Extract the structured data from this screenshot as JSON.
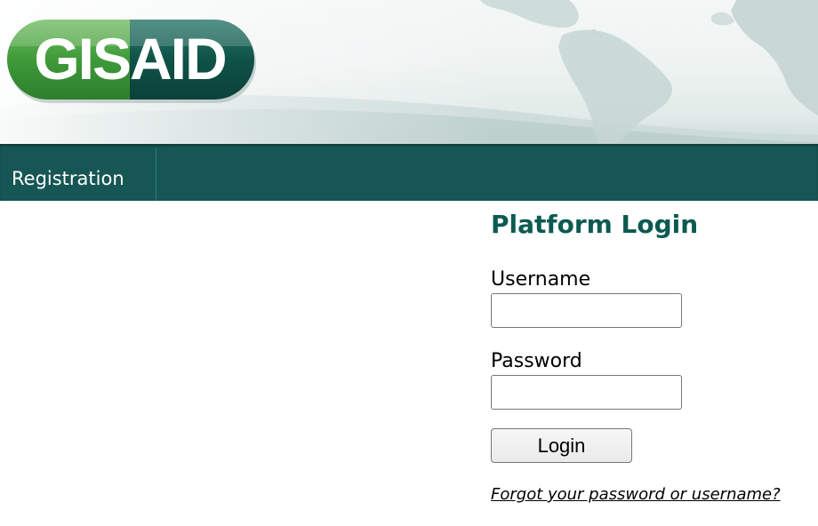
{
  "header": {
    "logo_text": "GISAID",
    "logo_icon": "gisaid-logo",
    "background_icon": "world-map-banner"
  },
  "nav": {
    "items": [
      {
        "label": "Registration"
      }
    ]
  },
  "login": {
    "title": "Platform Login",
    "username_label": "Username",
    "username_value": "",
    "password_label": "Password",
    "password_value": "",
    "submit_label": "Login",
    "forgot_label": "Forgot your password or username?"
  },
  "colors": {
    "nav_background": "#165654",
    "title_color": "#0c5a52",
    "logo_green": "#3e9a3a",
    "logo_dark": "#0d4f47"
  }
}
